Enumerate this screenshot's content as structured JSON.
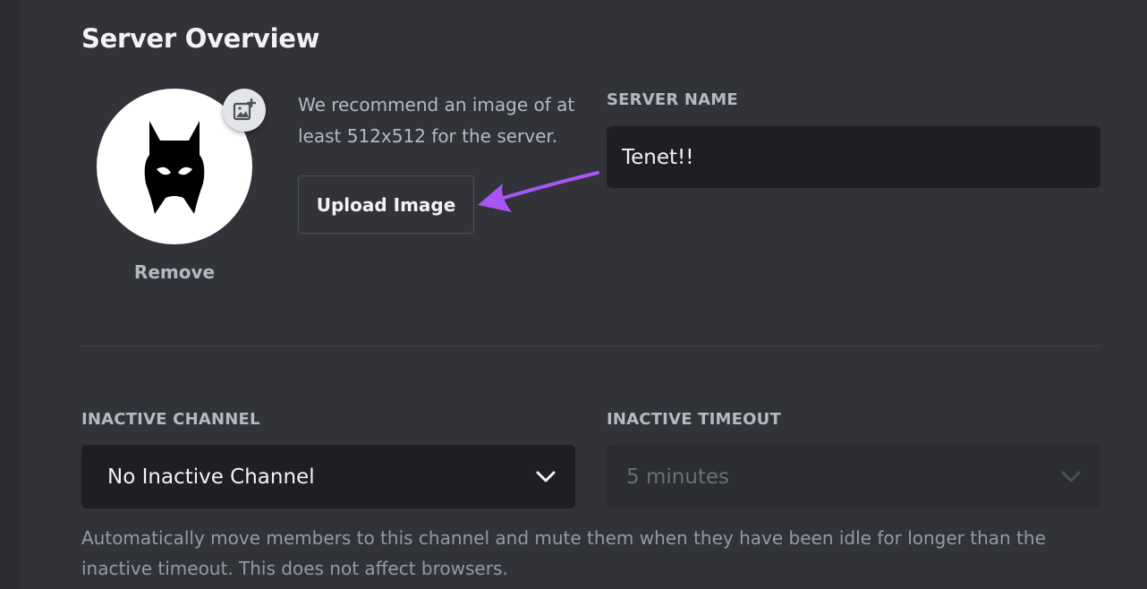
{
  "page": {
    "title": "Server Overview"
  },
  "server_icon": {
    "remove_label": "Remove",
    "recommendation": "We recommend an image of at least 512x512 for the server.",
    "upload_label": "Upload Image"
  },
  "server_name": {
    "label": "SERVER NAME",
    "value": "Tenet!!"
  },
  "inactive_channel": {
    "label": "INACTIVE CHANNEL",
    "selected": "No Inactive Channel"
  },
  "inactive_timeout": {
    "label": "INACTIVE TIMEOUT",
    "selected": "5 minutes"
  },
  "help_text": "Automatically move members to this channel and mute them when they have been idle for longer than the inactive timeout. This does not affect browsers.",
  "icons": {
    "avatar_image": "bat-mask-icon",
    "add_image": "image-plus-icon",
    "dropdown": "chevron-down-icon",
    "annotation": "arrow-icon"
  },
  "colors": {
    "background": "#313338",
    "input_background": "#1e1f22",
    "annotation_arrow": "#a855f7"
  }
}
